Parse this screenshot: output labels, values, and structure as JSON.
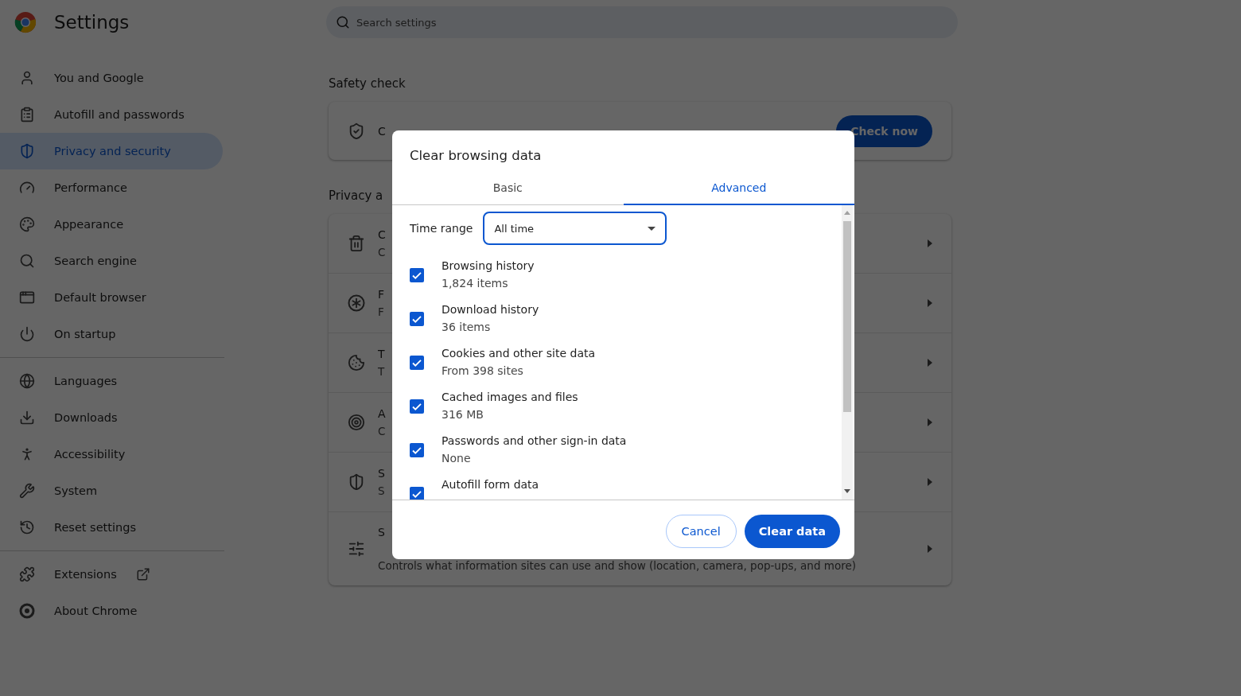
{
  "header": {
    "title": "Settings",
    "search": {
      "placeholder": "Search settings"
    }
  },
  "sidebar": {
    "groups": [
      {
        "items": [
          {
            "label": "You and Google",
            "selected": false,
            "external": false
          },
          {
            "label": "Autofill and passwords",
            "selected": false,
            "external": false
          },
          {
            "label": "Privacy and security",
            "selected": true,
            "external": false
          },
          {
            "label": "Performance",
            "selected": false,
            "external": false
          },
          {
            "label": "Appearance",
            "selected": false,
            "external": false
          },
          {
            "label": "Search engine",
            "selected": false,
            "external": false
          },
          {
            "label": "Default browser",
            "selected": false,
            "external": false
          },
          {
            "label": "On startup",
            "selected": false,
            "external": false
          }
        ]
      },
      {
        "items": [
          {
            "label": "Languages",
            "selected": false,
            "external": false
          },
          {
            "label": "Downloads",
            "selected": false,
            "external": false
          },
          {
            "label": "Accessibility",
            "selected": false,
            "external": false
          },
          {
            "label": "System",
            "selected": false,
            "external": false
          },
          {
            "label": "Reset settings",
            "selected": false,
            "external": false
          }
        ]
      },
      {
        "items": [
          {
            "label": "Extensions",
            "selected": false,
            "external": true
          },
          {
            "label": "About Chrome",
            "selected": false,
            "external": false
          }
        ]
      }
    ]
  },
  "safety_check": {
    "heading": "Safety check",
    "row_text": "C",
    "button": "Check now"
  },
  "privacy": {
    "heading": "Privacy a",
    "rows": [
      {
        "title": "C",
        "subtitle": "C"
      },
      {
        "title": "F",
        "subtitle": "F"
      },
      {
        "title": "T",
        "subtitle": "T"
      },
      {
        "title": "A",
        "subtitle": "C"
      },
      {
        "title": "S",
        "subtitle": "S"
      },
      {
        "title": "S",
        "subtitle": "Controls what information sites can use and show (location, camera, pop-ups, and more)"
      }
    ]
  },
  "dialog": {
    "title": "Clear browsing data",
    "tabs": [
      {
        "label": "Basic",
        "selected": false
      },
      {
        "label": "Advanced",
        "selected": true
      }
    ],
    "time_range": {
      "label": "Time range",
      "value": "All time"
    },
    "items": [
      {
        "label": "Browsing history",
        "detail": "1,824 items",
        "checked": true
      },
      {
        "label": "Download history",
        "detail": "36 items",
        "checked": true
      },
      {
        "label": "Cookies and other site data",
        "detail": "From 398 sites",
        "checked": true
      },
      {
        "label": "Cached images and files",
        "detail": "316 MB",
        "checked": true
      },
      {
        "label": "Passwords and other sign-in data",
        "detail": "None",
        "checked": true
      },
      {
        "label": "Autofill form data",
        "checked": true
      }
    ],
    "buttons": {
      "cancel": "Cancel",
      "confirm": "Clear data"
    }
  }
}
